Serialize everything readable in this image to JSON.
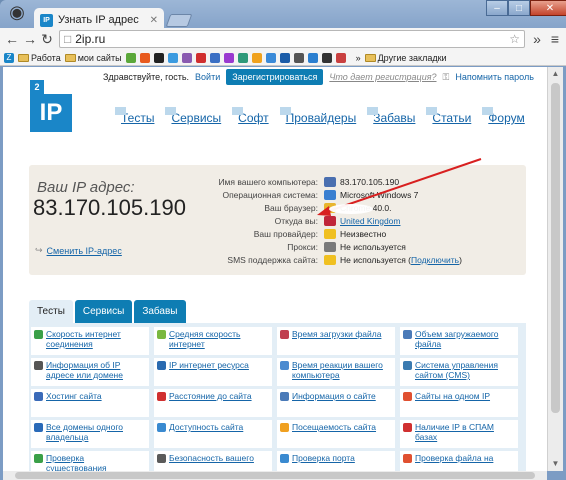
{
  "browser": {
    "tab_title": "Узнать IP адрес",
    "tab_icon": "IP",
    "url": "2ip.ru",
    "bookmarks": [
      {
        "label": "Работа",
        "type": "folder"
      },
      {
        "label": "мои сайты",
        "type": "folder"
      },
      {
        "label": "",
        "type": "icon",
        "color": "#5ba83a"
      },
      {
        "label": "",
        "type": "icon",
        "color": "#e85a1e"
      },
      {
        "label": "",
        "type": "icon",
        "color": "#222222"
      },
      {
        "label": "",
        "type": "icon",
        "color": "#3b9be0"
      },
      {
        "label": "",
        "type": "icon",
        "color": "#8a5ab0"
      },
      {
        "label": "",
        "type": "icon",
        "color": "#d02e2e"
      },
      {
        "label": "",
        "type": "icon",
        "color": "#3a6fc4"
      },
      {
        "label": "",
        "type": "icon",
        "color": "#9a3ad0"
      },
      {
        "label": "",
        "type": "icon",
        "color": "#2f9a7a"
      },
      {
        "label": "",
        "type": "icon",
        "color": "#f0a21e"
      },
      {
        "label": "",
        "type": "icon",
        "color": "#3a8ad8"
      },
      {
        "label": "",
        "type": "icon",
        "color": "#1b5ca8"
      },
      {
        "label": "",
        "type": "icon",
        "color": "#555555"
      },
      {
        "label": "",
        "type": "icon",
        "color": "#2b7fd0"
      },
      {
        "label": "",
        "type": "icon",
        "color": "#333333"
      },
      {
        "label": "",
        "type": "icon",
        "color": "#c94040"
      }
    ],
    "bookmarks_more": "»",
    "other_bookmarks": "Другие закладки"
  },
  "page": {
    "greeting": "Здравствуйте, гость.",
    "login": "Войти",
    "register": "Зарегистрироваться",
    "why_register": "Что дает регистрация?",
    "remind_password": "Напомнить пароль",
    "logo_top": "2",
    "logo_main": "IP",
    "menu": [
      "Тесты",
      "Сервисы",
      "Софт",
      "Провайдеры",
      "Забавы",
      "Статьи",
      "Форум"
    ],
    "ip_label": "Ваш IP адрес:",
    "ip_value": "83.170.105.190",
    "change_ip": "Сменить IP-адрес",
    "info": [
      {
        "key": "Имя вашего компьютера:",
        "value": "83.170.105.190",
        "icon_color": "#4a6fb0"
      },
      {
        "key": "Операционная система:",
        "value": "Microsoft Windows 7",
        "icon_color": "#3a7fd0"
      },
      {
        "key": "Ваш браузер:",
        "value": "Chrome 40.0.",
        "icon_color": "#e8b52e"
      },
      {
        "key": "Откуда вы:",
        "value": "United Kingdom",
        "icon_color": "#c0263a",
        "link": true
      },
      {
        "key": "Ваш провайдер:",
        "value": "Неизвестно",
        "icon_color": "#f0c020"
      },
      {
        "key": "Прокси:",
        "value": "Не используется",
        "icon_color": "#7a7a7a"
      },
      {
        "key": "SMS поддержка сайта:",
        "value": "Не используется (",
        "link_text": "Подключить",
        "value_end": ")",
        "icon_color": "#f0c020"
      }
    ],
    "tabs": [
      "Тесты",
      "Сервисы",
      "Забавы"
    ],
    "services": [
      {
        "label": "Скорость интернет соединения",
        "color": "#3aa048"
      },
      {
        "label": "Средняя скорость интернет",
        "color": "#7ab840"
      },
      {
        "label": "Время загрузки файла",
        "color": "#c04050"
      },
      {
        "label": "Объем загружаемого файла",
        "color": "#4a7ab8"
      },
      {
        "label": "Информация об IP адресе или домене",
        "color": "#555555"
      },
      {
        "label": "IP интернет ресурса",
        "color": "#2a6ab0"
      },
      {
        "label": "Время реакции вашего компьютера",
        "color": "#4a8ad0"
      },
      {
        "label": "Система управления сайтом (CMS)",
        "color": "#3a7ab0"
      },
      {
        "label": "Хостинг сайта",
        "color": "#3a6ab8"
      },
      {
        "label": "Расстояние до сайта",
        "color": "#d03030"
      },
      {
        "label": "Информация о сайте",
        "color": "#4a7ab8"
      },
      {
        "label": "Сайты на одном IP",
        "color": "#e05030"
      },
      {
        "label": "Все домены одного владельца",
        "color": "#2a6ab8"
      },
      {
        "label": "Доступность сайта",
        "color": "#3a8ad0"
      },
      {
        "label": "Посещаемость сайта",
        "color": "#f0a020"
      },
      {
        "label": "Наличие IP в СПАМ базах",
        "color": "#d03030"
      },
      {
        "label": "Проверка существования",
        "color": "#3aa048"
      },
      {
        "label": "Безопасность вашего",
        "color": "#5a5a5a"
      },
      {
        "label": "Проверка порта",
        "color": "#3a8ad0"
      },
      {
        "label": "Проверка файла на",
        "color": "#e05030"
      }
    ]
  }
}
